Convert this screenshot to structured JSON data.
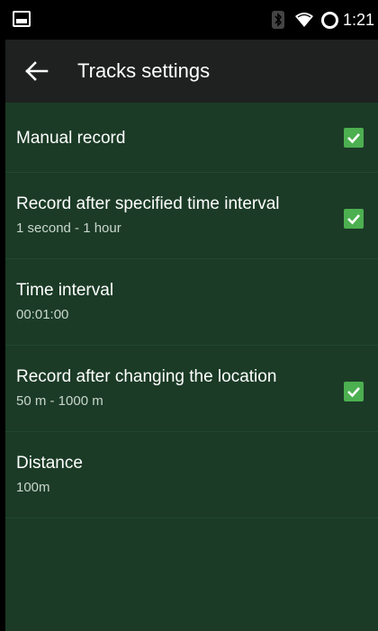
{
  "status_bar": {
    "time": "1:21",
    "icons": [
      "notification-icon",
      "bluetooth-icon",
      "wifi-icon",
      "sync-icon"
    ]
  },
  "toolbar": {
    "back_icon": "arrow-left-icon",
    "title": "Tracks settings"
  },
  "settings": [
    {
      "label": "Manual record",
      "summary": "",
      "checked": true
    },
    {
      "label": "Record after specified time interval",
      "summary": "1 second - 1 hour",
      "checked": true
    },
    {
      "label": "Time interval",
      "summary": "00:01:00"
    },
    {
      "label": "Record after changing the location",
      "summary": "50 m - 1000 m",
      "checked": true
    },
    {
      "label": "Distance",
      "summary": "100m"
    }
  ],
  "colors": {
    "background": "#1b3b26",
    "toolbar": "#1e2120",
    "checkbox": "#4caf50"
  }
}
